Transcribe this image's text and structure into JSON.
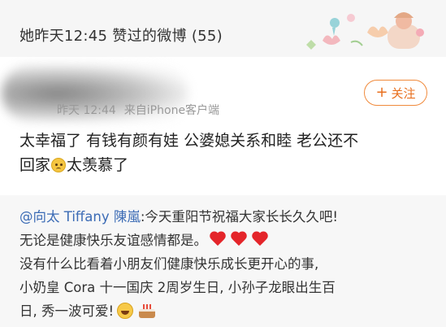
{
  "header": {
    "title": "她昨天12:45 赞过的微博 (55)"
  },
  "post": {
    "time": "昨天 12:44",
    "source": "来自iPhone客户端",
    "follow_label": "关注",
    "text_line1": "太幸福了 有钱有颜有娃 公婆媳关系和睦 老公还不",
    "text_line2_a": "回家",
    "text_line2_b": "太羡慕了"
  },
  "repost": {
    "mention": "@向太 Tiffany 陳嵐",
    "line1_rest": ":今天重阳节祝福大家长长久久吧!",
    "line2": "无论是健康快乐友谊感情都是。",
    "line3": "没有什么比看着小朋友们健康快乐成长更开心的事,",
    "line4": "小奶皇 Cora 十一国庆 2周岁生日, 小孙子龙眼出生百",
    "line5": "日, 秀一波可爱!"
  },
  "colors": {
    "accent": "#e86f1e",
    "mention": "#3b6bb5",
    "header_bg": "#f6f6f6",
    "repost_bg": "#f7f7f7"
  },
  "icons": [
    "plus-icon",
    "sad-face-emoji",
    "heart-emoji",
    "laughing-emoji",
    "birthday-cake-emoji"
  ]
}
